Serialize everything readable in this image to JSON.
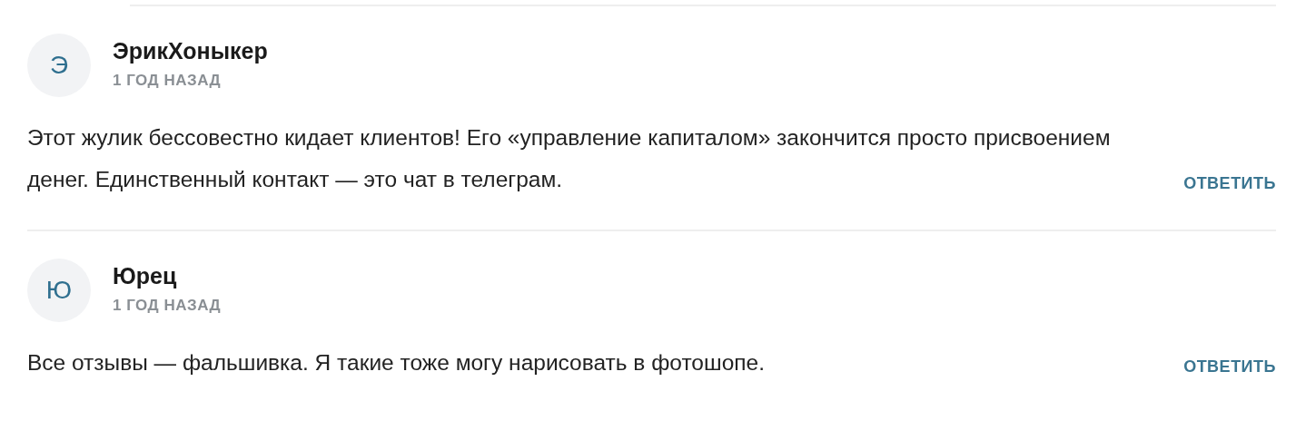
{
  "comments": [
    {
      "avatar": "Э",
      "author": "ЭрикХоныкер",
      "time": "1 ГОД НАЗАД",
      "text": "Этот жулик бессовестно кидает клиентов! Его «управление капиталом» закончится просто присвоением денег. Единственный контакт — это чат в телеграм.",
      "reply": "ОТВЕТИТЬ"
    },
    {
      "avatar": "Ю",
      "author": "Юрец",
      "time": "1 ГОД НАЗАД",
      "text": "Все отзывы — фальшивка. Я такие тоже могу нарисовать в фотошопе.",
      "reply": "ОТВЕТИТЬ"
    }
  ]
}
